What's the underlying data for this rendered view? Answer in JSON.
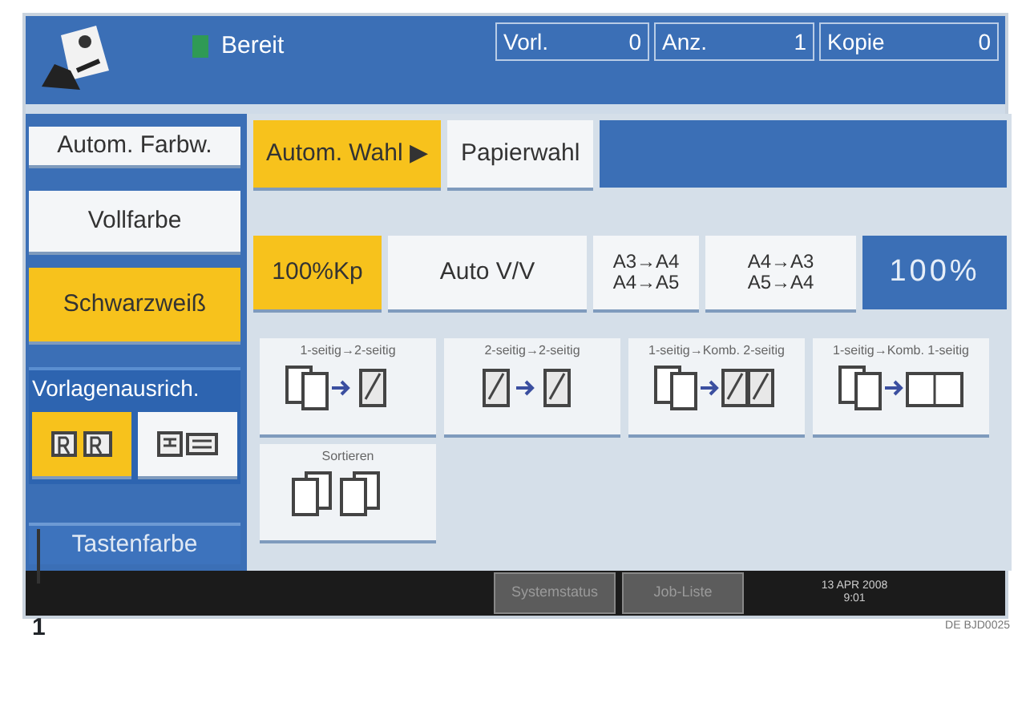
{
  "header": {
    "status": "Bereit",
    "counters": [
      {
        "label": "Vorl.",
        "value": "0"
      },
      {
        "label": "Anz.",
        "value": "1"
      },
      {
        "label": "Kopie",
        "value": "0"
      }
    ]
  },
  "color_modes": [
    {
      "label": "Autom. Farbw.",
      "selected": false
    },
    {
      "label": "Vollfarbe",
      "selected": false
    },
    {
      "label": "Schwarzweiß",
      "selected": true
    }
  ],
  "orientation": {
    "label": "Vorlagenausrich.",
    "options": [
      {
        "kind": "portrait",
        "selected": true
      },
      {
        "kind": "landscape",
        "selected": false
      }
    ]
  },
  "key_color_button": "Tastenfarbe",
  "paper": [
    {
      "label": "Autom. Wahl ▶",
      "selected": true
    },
    {
      "label": "Papierwahl",
      "selected": false
    }
  ],
  "ratio": [
    {
      "lines": [
        "100%Kp"
      ],
      "selected": true
    },
    {
      "lines": [
        "Auto V/V"
      ],
      "selected": false
    },
    {
      "lines": [
        "A3→A4",
        "A4→A5"
      ],
      "selected": false
    },
    {
      "lines": [
        "A4→A3",
        "A5→A4"
      ],
      "selected": false
    }
  ],
  "ratio_display": "100%",
  "duplex": [
    {
      "label": "1-seitig→2-seitig",
      "kind": "one-two"
    },
    {
      "label": "2-seitig→2-seitig",
      "kind": "two-two"
    },
    {
      "label": "1-seitig→Komb. 2-seitig",
      "kind": "combine-two"
    },
    {
      "label": "1-seitig→Komb. 1-seitig",
      "kind": "combine-one"
    },
    {
      "label": "Sortieren",
      "kind": "sort"
    }
  ],
  "bottom_bar": {
    "buttons": [
      "Systemstatus",
      "Job-Liste"
    ],
    "date": "13 APR 2008",
    "time": "9:01"
  },
  "callout": "1",
  "figure_code": "DE BJD0025"
}
